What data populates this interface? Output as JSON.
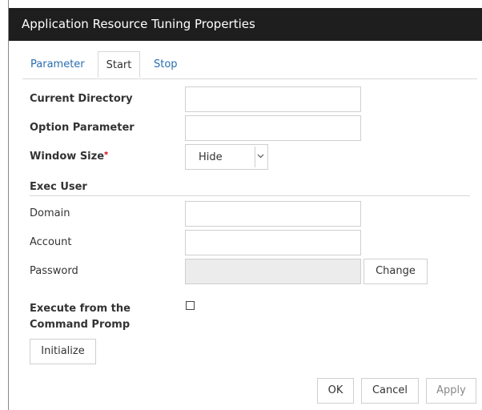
{
  "dialog": {
    "title": "Application Resource Tuning Properties"
  },
  "tabs": [
    {
      "label": "Parameter"
    },
    {
      "label": "Start"
    },
    {
      "label": "Stop"
    }
  ],
  "fields": {
    "current_directory": {
      "label": "Current Directory",
      "value": ""
    },
    "option_parameter": {
      "label": "Option Parameter",
      "value": ""
    },
    "window_size": {
      "label": "Window Size",
      "required_mark": "*",
      "selected": "Hide"
    }
  },
  "exec_user": {
    "section_label": "Exec User",
    "domain": {
      "label": "Domain",
      "value": ""
    },
    "account": {
      "label": "Account",
      "value": ""
    },
    "password": {
      "label": "Password",
      "value": "",
      "change_label": "Change"
    }
  },
  "execute_from_cmd": {
    "label_line1": "Execute from the",
    "label_line2": "Command Promp",
    "checked": false
  },
  "buttons": {
    "initialize": "Initialize",
    "ok": "OK",
    "cancel": "Cancel",
    "apply": "Apply"
  }
}
